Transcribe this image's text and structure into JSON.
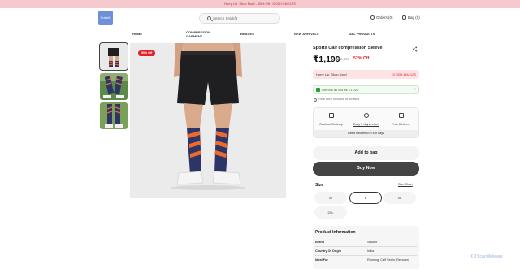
{
  "promo": {
    "text": "Hurry Up, Shop Now! - 50% Off",
    "timer": "00H:14M:12S"
  },
  "header": {
    "logo_text": "Snickfit",
    "search_placeholder": "Search Snickfit",
    "orders_label": "Orders (0)",
    "bag_label": "Bag (0)"
  },
  "nav": {
    "items": [
      {
        "label": "HOME"
      },
      {
        "label": "COMPRESSION GARMENT"
      },
      {
        "label": "BRACES"
      },
      {
        "label": "NEW ARRIVALS"
      },
      {
        "label": "ALL PRODUCTS"
      }
    ]
  },
  "gallery": {
    "discount_badge": "50% Off",
    "thumbnails": [
      {
        "alt": "front view thumbnail",
        "active": true
      },
      {
        "alt": "side view thumbnail",
        "active": false
      },
      {
        "alt": "back view thumbnail",
        "active": false
      }
    ]
  },
  "product": {
    "title": "Sports Calf compression Sleeve",
    "price": "₹1,199",
    "mrp": "₹2,499",
    "discount": "52% Off",
    "hurry_text": "Hurry Up, Shop Now!",
    "hurry_timer": "⊙ 00H:14M:12S",
    "deal_text": "Get this as low as ₹1,020",
    "final_price_note": "Final Price Inclusive of all taxes",
    "features": [
      {
        "label": "Cash on Delivery",
        "icon": "rupee-icon"
      },
      {
        "label": "Easy 5 days return",
        "icon": "return-icon"
      },
      {
        "label": "Free Delivery",
        "icon": "truck-icon"
      }
    ],
    "delivery_text": "Get it delivered in 4-9 days",
    "add_to_bag": "Add to bag",
    "buy_now": "Buy Now",
    "size_label": "Size",
    "size_chart": "Size Chart",
    "sizes": [
      {
        "label": "M",
        "selected": false
      },
      {
        "label": "L",
        "selected": true
      },
      {
        "label": "XL",
        "selected": false
      },
      {
        "label": "2XL",
        "selected": false
      }
    ]
  },
  "product_info": {
    "heading": "Product Information",
    "rows": [
      {
        "key": "Brand",
        "value": "Snickfit"
      },
      {
        "key": "Country Of Origin",
        "value": "India"
      },
      {
        "key": "Ideal For",
        "value": "Running, Calf Strain, Recovery"
      }
    ]
  },
  "watermark": "ScanMalware",
  "colors": {
    "promo_bg": "#f6c9cf",
    "accent_red": "#e0202a",
    "buy_now_bg": "#444444",
    "deal_green": "#2c9b3b",
    "shorts": "#1f1f22",
    "sock_navy": "#2c3566",
    "sock_stripe": "#ee6a2a"
  }
}
